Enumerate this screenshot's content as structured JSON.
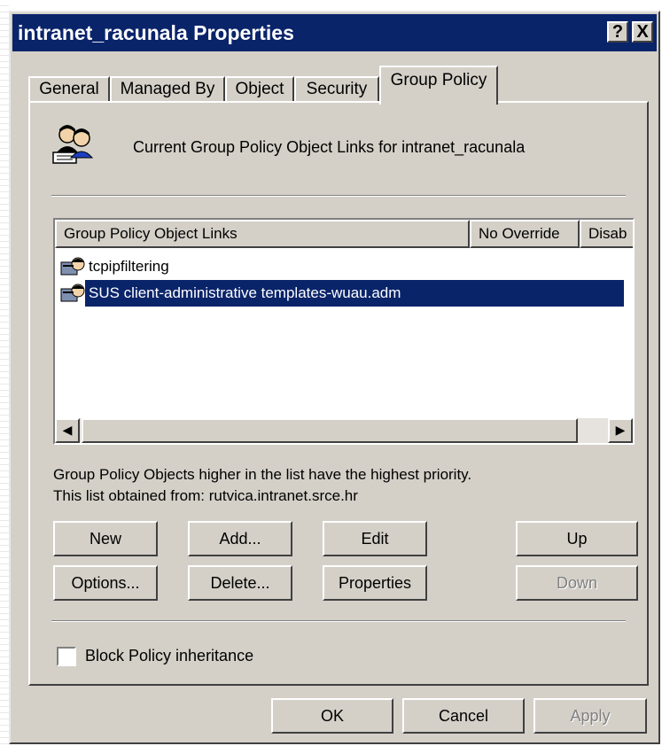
{
  "window": {
    "title": "intranet_racunala Properties",
    "help_button": "?",
    "close_button": "X"
  },
  "tabs": [
    {
      "label": "General"
    },
    {
      "label": "Managed By"
    },
    {
      "label": "Object"
    },
    {
      "label": "Security"
    },
    {
      "label": "Group Policy",
      "active": true
    }
  ],
  "header": {
    "icon": "group-policy-users-icon",
    "text": "Current Group Policy Object Links for intranet_racunala"
  },
  "list": {
    "columns": [
      "Group Policy Object Links",
      "No Override",
      "Disab"
    ],
    "rows": [
      {
        "name": "tcpipfiltering",
        "icon": "gpo-link-icon",
        "selected": false
      },
      {
        "name": "SUS client-administrative templates-wuau.adm",
        "icon": "gpo-link-icon",
        "selected": true
      }
    ],
    "scroll_left": "◀",
    "scroll_right": "▶"
  },
  "info": {
    "line1": "Group Policy Objects higher in the list have the highest priority.",
    "line2": "This list obtained from: rutvica.intranet.srce.hr"
  },
  "buttons": {
    "new": "New",
    "add": "Add...",
    "edit": "Edit",
    "up": "Up",
    "options": "Options...",
    "delete": "Delete...",
    "properties": "Properties",
    "down": "Down"
  },
  "block_inheritance": {
    "label": "Block Policy inheritance",
    "checked": false
  },
  "footer": {
    "ok": "OK",
    "cancel": "Cancel",
    "apply": "Apply"
  },
  "colors": {
    "titlebar": "#0a246a",
    "face": "#d4d0c8",
    "selection": "#0a246a"
  }
}
